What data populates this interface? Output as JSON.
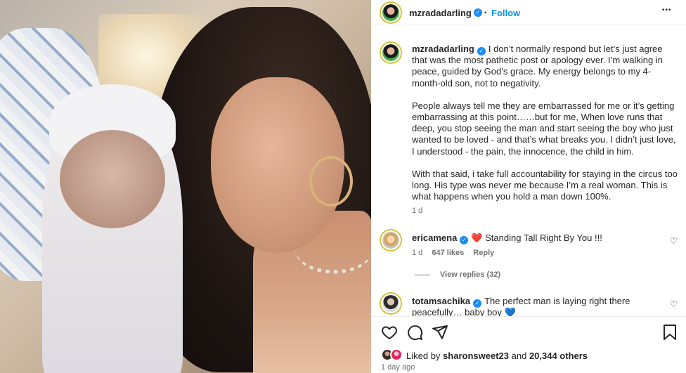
{
  "post": {
    "username": "mzradadarling",
    "follow_label": "Follow",
    "separator": "•",
    "more_label": "•••"
  },
  "caption": {
    "username": "mzradadarling",
    "paragraph_1": "I don’t normally respond but let’s just agree that was the most pathetic post or apology ever. I’m walking in peace, guided by God’s grace. My energy belongs to my 4-month-old son, not to negativity.",
    "paragraph_2": "People always tell me they are embarrassed for me or it’s getting embarrassing at this point……but for me, When love runs that deep, you stop seeing the man and start seeing the boy who just wanted to be loved - and that’s what breaks you. I didn’t just love, I understood - the pain, the innocence, the child in him.",
    "paragraph_3": "With that said, i take full accountability for staying in the circus too long. His type was never me because I’m a real woman. This is what happens when you hold a man down 100%.",
    "time": "1 d"
  },
  "comments": [
    {
      "username": "ericamena",
      "text": "❤️ Standing Tall Right By You !!!",
      "time": "1 d",
      "likes": "647 likes",
      "reply": "Reply",
      "view_replies": "View replies (32)"
    },
    {
      "username": "totamsachika",
      "text": "The perfect man is laying right there peacefully… baby boy 💙"
    }
  ],
  "footer": {
    "liked_by_prefix": "Liked by",
    "liked_by_user": "sharonsweet23",
    "liked_by_and": "and",
    "liked_by_count": "20,344 others",
    "time_ago": "1 day ago"
  },
  "colors": {
    "accent": "#0095f6",
    "verified": "#1a8cf5",
    "heart": "#e0245e"
  }
}
